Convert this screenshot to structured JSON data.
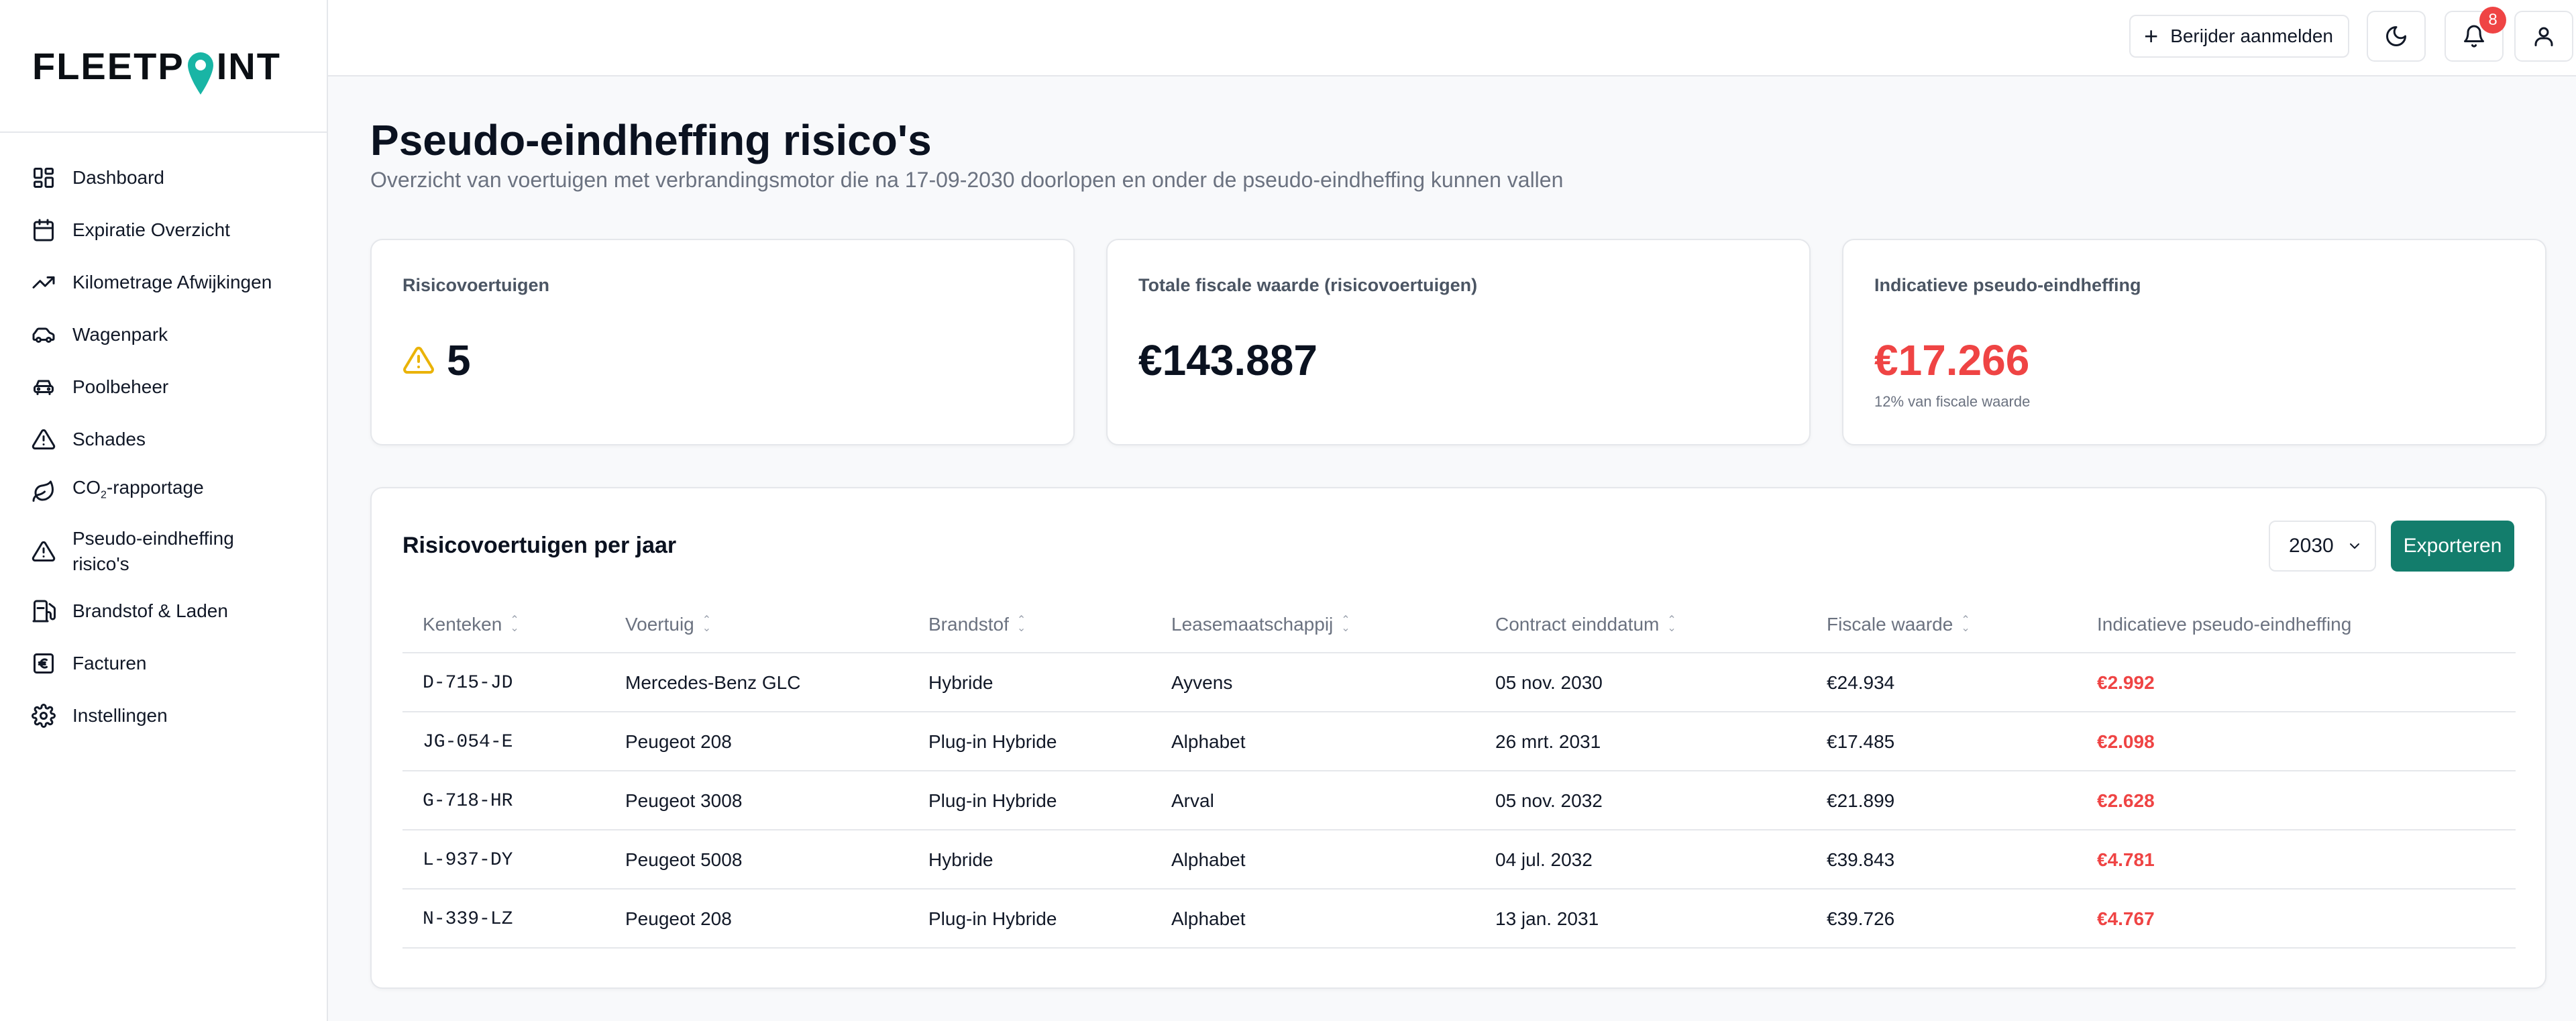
{
  "brand": {
    "name_pre": "FLEETP",
    "name_post": "INT",
    "accent": "#19b5a5"
  },
  "sidebar": {
    "items": [
      {
        "label": "Dashboard",
        "icon": "dashboard-icon"
      },
      {
        "label": "Expiratie Overzicht",
        "icon": "calendar-icon"
      },
      {
        "label": "Kilometrage Afwijkingen",
        "icon": "trend-icon"
      },
      {
        "label": "Wagenpark",
        "icon": "car-icon"
      },
      {
        "label": "Poolbeheer",
        "icon": "car-front-icon"
      },
      {
        "label": "Schades",
        "icon": "warning-icon"
      },
      {
        "label_pre": "CO",
        "label_sub": "2",
        "label_post": "-rapportage",
        "icon": "leaf-icon"
      },
      {
        "label_line1": "Pseudo-eindheffing",
        "label_line2": "risico's",
        "icon": "warning-icon"
      },
      {
        "label": "Brandstof & Laden",
        "icon": "fuel-icon"
      },
      {
        "label": "Facturen",
        "icon": "euro-icon"
      },
      {
        "label": "Instellingen",
        "icon": "gear-icon"
      }
    ]
  },
  "topbar": {
    "register_label": "Berijder aanmelden",
    "notification_count": "8"
  },
  "page": {
    "title": "Pseudo-eindheffing risico's",
    "subtitle": "Overzicht van voertuigen met verbrandingsmotor die na 17-09-2030 doorlopen en onder de pseudo-eindheffing kunnen vallen"
  },
  "cards": {
    "risk": {
      "label": "Risicovoertuigen",
      "value": "5"
    },
    "fiscal": {
      "label": "Totale fiscale waarde (risicovoertuigen)",
      "value": "€143.887"
    },
    "tax": {
      "label": "Indicatieve pseudo-eindheffing",
      "value": "€17.266",
      "sub": "12% van fiscale waarde"
    }
  },
  "table": {
    "title": "Risicovoertuigen per jaar",
    "year": "2030",
    "export_label": "Exporteren",
    "headers": [
      "Kenteken",
      "Voertuig",
      "Brandstof",
      "Leasemaatschappij",
      "Contract einddatum",
      "Fiscale waarde",
      "Indicatieve pseudo-eindheffing"
    ],
    "rows": [
      [
        "D-715-JD",
        "Mercedes-Benz GLC",
        "Hybride",
        "Ayvens",
        "05 nov. 2030",
        "€24.934",
        "€2.992"
      ],
      [
        "JG-054-E",
        "Peugeot 208",
        "Plug-in Hybride",
        "Alphabet",
        "26 mrt. 2031",
        "€17.485",
        "€2.098"
      ],
      [
        "G-718-HR",
        "Peugeot 3008",
        "Plug-in Hybride",
        "Arval",
        "05 nov. 2032",
        "€21.899",
        "€2.628"
      ],
      [
        "L-937-DY",
        "Peugeot 5008",
        "Hybride",
        "Alphabet",
        "04 jul. 2032",
        "€39.843",
        "€4.781"
      ],
      [
        "N-339-LZ",
        "Peugeot 208",
        "Plug-in Hybride",
        "Alphabet",
        "13 jan. 2031",
        "€39.726",
        "€4.767"
      ]
    ]
  }
}
